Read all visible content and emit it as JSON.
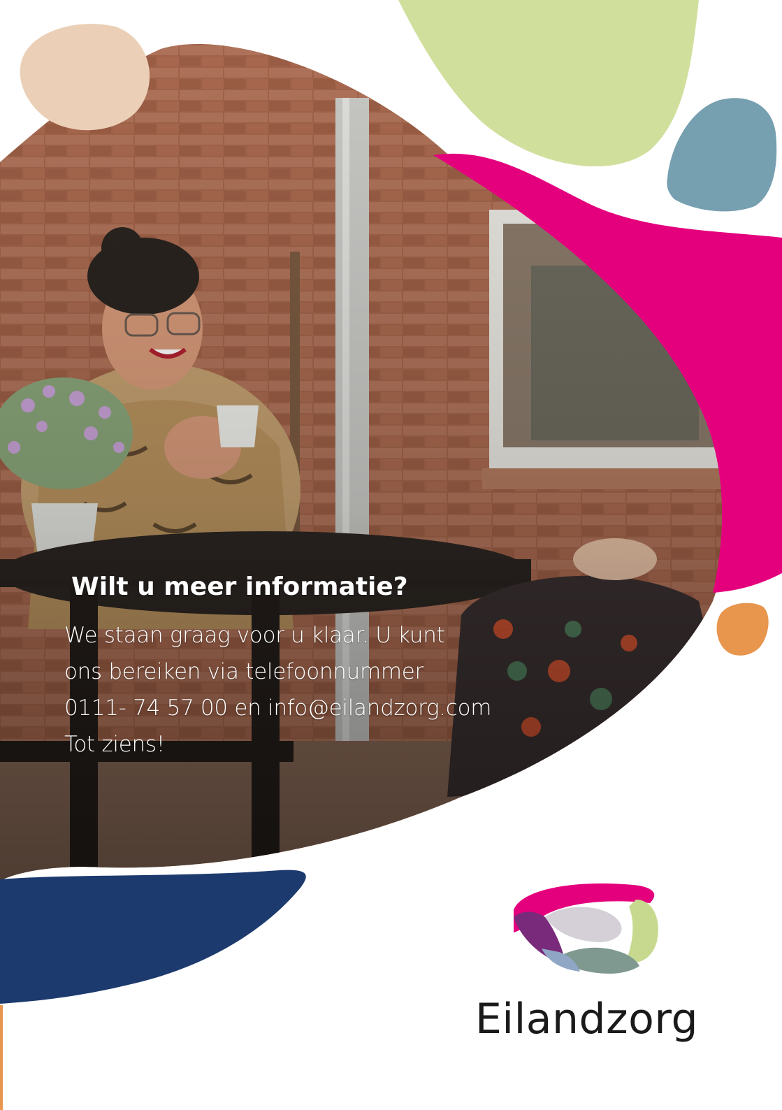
{
  "info": {
    "heading": "Wilt u meer informatie?",
    "lines": [
      "We staan graag voor u klaar. U kunt",
      "ons bereiken via telefoonnummer",
      "0111- 74 57 00 en info@eilandzorg.com",
      "Tot ziens!"
    ]
  },
  "brand": {
    "name": "Eilandzorg"
  },
  "colors": {
    "pink": "#e4007d",
    "lime": "#d1df9d",
    "steel_blue": "#769fb0",
    "navy": "#1d3a6e",
    "sand": "#ebd0b7",
    "orange": "#e8954e"
  },
  "icons": [
    "eilandzorg-logo-icon"
  ]
}
